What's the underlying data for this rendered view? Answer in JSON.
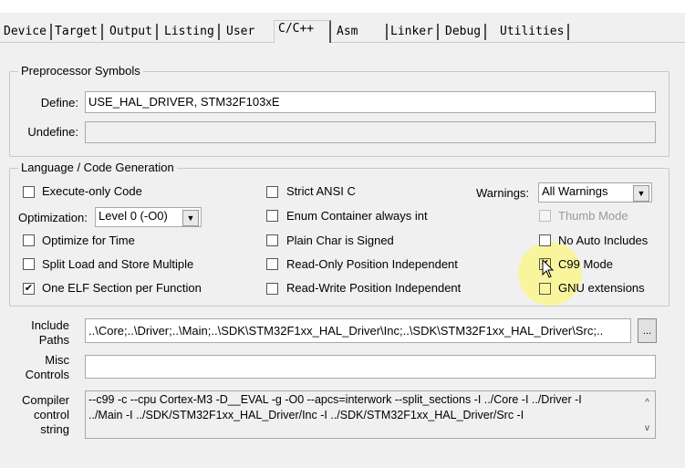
{
  "tabs": [
    "Device",
    "Target",
    "Output",
    "Listing",
    "User",
    "C/C++",
    "Asm",
    "Linker",
    "Debug",
    "Utilities"
  ],
  "active_tab": "C/C++",
  "preprocessor": {
    "title": "Preprocessor Symbols",
    "define_label": "Define:",
    "define_value": "USE_HAL_DRIVER, STM32F103xE",
    "undefine_label": "Undefine:",
    "undefine_value": ""
  },
  "language": {
    "title": "Language / Code Generation",
    "execute_only": {
      "label": "Execute-only Code",
      "checked": false
    },
    "optimization_label": "Optimization:",
    "optimization_value": "Level 0 (-O0)",
    "optimize_time": {
      "label": "Optimize for Time",
      "checked": false
    },
    "split_load": {
      "label": "Split Load and Store Multiple",
      "checked": false
    },
    "one_elf": {
      "label": "One ELF Section per Function",
      "checked": true
    },
    "strict_ansi": {
      "label": "Strict ANSI C",
      "checked": false
    },
    "enum_container": {
      "label": "Enum Container always int",
      "checked": false
    },
    "plain_char": {
      "label": "Plain Char is Signed",
      "checked": false
    },
    "ro_pi": {
      "label": "Read-Only Position Independent",
      "checked": false
    },
    "rw_pi": {
      "label": "Read-Write Position Independent",
      "checked": false
    },
    "warnings_label": "Warnings:",
    "warnings_value": "All Warnings",
    "thumb_mode": {
      "label": "Thumb Mode",
      "checked": false,
      "disabled": true
    },
    "no_auto_includes": {
      "label": "No Auto Includes",
      "checked": false
    },
    "c99_mode": {
      "label": "C99 Mode",
      "checked": true
    },
    "gnu_extensions": {
      "label": "GNU extensions",
      "checked": false
    }
  },
  "include_paths": {
    "label1": "Include",
    "label2": "Paths",
    "value": "..\\Core;..\\Driver;..\\Main;..\\SDK\\STM32F1xx_HAL_Driver\\Inc;..\\SDK\\STM32F1xx_HAL_Driver\\Src;..",
    "browse": "..."
  },
  "misc": {
    "label1": "Misc",
    "label2": "Controls",
    "value": ""
  },
  "compiler": {
    "label1": "Compiler",
    "label2": "control",
    "label3": "string",
    "line1": "--c99 -c --cpu Cortex-M3 -D__EVAL -g -O0 --apcs=interwork --split_sections -I ../Core -I ../Driver -I",
    "line2": "../Main -I ../SDK/STM32F1xx_HAL_Driver/Inc -I ../SDK/STM32F1xx_HAL_Driver/Src -I"
  }
}
